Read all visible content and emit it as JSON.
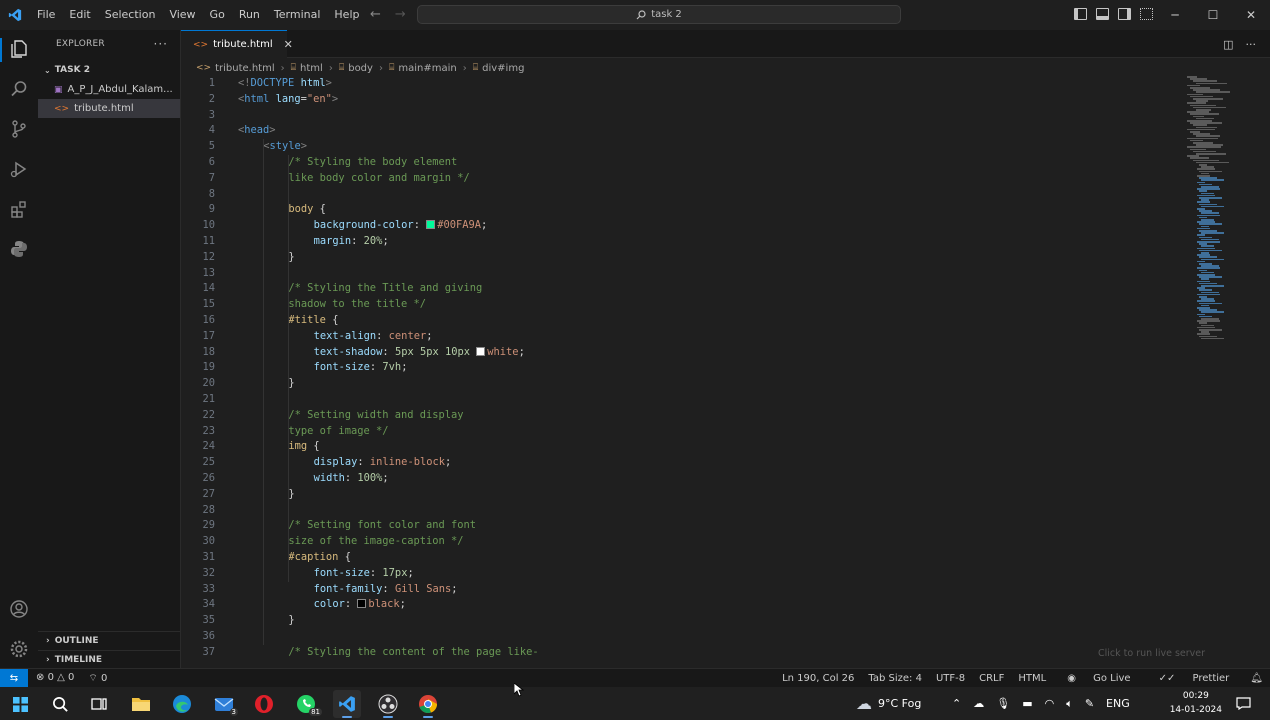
{
  "window": {
    "menu": [
      "File",
      "Edit",
      "Selection",
      "View",
      "Go",
      "Run",
      "Terminal",
      "Help"
    ],
    "search_text": "task 2"
  },
  "explorer": {
    "header": "EXPLORER",
    "folder": "TASK 2",
    "files": [
      {
        "name": "A_P_J_Abdul_Kalam...",
        "type": "image"
      },
      {
        "name": "tribute.html",
        "type": "html",
        "selected": true
      }
    ],
    "outline_label": "OUTLINE",
    "timeline_label": "TIMELINE"
  },
  "tab": {
    "label": "tribute.html"
  },
  "breadcrumb": [
    "tribute.html",
    "html",
    "body",
    "main#main",
    "div#img"
  ],
  "editor": {
    "lines": [
      {
        "n": "1",
        "tokens": [
          {
            "c": "punc",
            "t": "<!"
          },
          {
            "c": "tag",
            "t": "DOCTYPE"
          },
          {
            "c": "plain",
            "t": " "
          },
          {
            "c": "attr",
            "t": "html"
          },
          {
            "c": "punc",
            "t": ">"
          }
        ],
        "indent": 0
      },
      {
        "n": "2",
        "tokens": [
          {
            "c": "punc",
            "t": "<"
          },
          {
            "c": "tag",
            "t": "html"
          },
          {
            "c": "plain",
            "t": " "
          },
          {
            "c": "attr",
            "t": "lang"
          },
          {
            "c": "plain",
            "t": "="
          },
          {
            "c": "str",
            "t": "\"en\""
          },
          {
            "c": "punc",
            "t": ">"
          }
        ],
        "indent": 0
      },
      {
        "n": "3",
        "tokens": [],
        "indent": 0
      },
      {
        "n": "4",
        "tokens": [
          {
            "c": "punc",
            "t": "<"
          },
          {
            "c": "tag",
            "t": "head"
          },
          {
            "c": "punc",
            "t": ">"
          }
        ],
        "indent": 0
      },
      {
        "n": "5",
        "tokens": [
          {
            "c": "punc",
            "t": "<"
          },
          {
            "c": "tag",
            "t": "style"
          },
          {
            "c": "punc",
            "t": ">"
          }
        ],
        "indent": 1
      },
      {
        "n": "6",
        "tokens": [
          {
            "c": "com",
            "t": "/* Styling the body element"
          }
        ],
        "indent": 2
      },
      {
        "n": "7",
        "tokens": [
          {
            "c": "com",
            "t": "like body color and margin */"
          }
        ],
        "indent": 2
      },
      {
        "n": "8",
        "tokens": [],
        "indent": 0
      },
      {
        "n": "9",
        "tokens": [
          {
            "c": "sel",
            "t": "body"
          },
          {
            "c": "plain",
            "t": " {"
          }
        ],
        "indent": 2
      },
      {
        "n": "10",
        "tokens": [
          {
            "c": "prop",
            "t": "background-color"
          },
          {
            "c": "plain",
            "t": ": "
          },
          {
            "c": "swatch",
            "t": "#00FA9A"
          },
          {
            "c": "val",
            "t": "#00FA9A"
          },
          {
            "c": "plain",
            "t": ";"
          }
        ],
        "indent": 3
      },
      {
        "n": "11",
        "tokens": [
          {
            "c": "prop",
            "t": "margin"
          },
          {
            "c": "plain",
            "t": ": "
          },
          {
            "c": "num",
            "t": "20%"
          },
          {
            "c": "plain",
            "t": ";"
          }
        ],
        "indent": 3
      },
      {
        "n": "12",
        "tokens": [
          {
            "c": "plain",
            "t": "}"
          }
        ],
        "indent": 2
      },
      {
        "n": "13",
        "tokens": [],
        "indent": 0
      },
      {
        "n": "14",
        "tokens": [
          {
            "c": "com",
            "t": "/* Styling the Title and giving"
          }
        ],
        "indent": 2
      },
      {
        "n": "15",
        "tokens": [
          {
            "c": "com",
            "t": "shadow to the title */"
          }
        ],
        "indent": 2
      },
      {
        "n": "16",
        "tokens": [
          {
            "c": "sel",
            "t": "#title"
          },
          {
            "c": "plain",
            "t": " {"
          }
        ],
        "indent": 2
      },
      {
        "n": "17",
        "tokens": [
          {
            "c": "prop",
            "t": "text-align"
          },
          {
            "c": "plain",
            "t": ": "
          },
          {
            "c": "val",
            "t": "center"
          },
          {
            "c": "plain",
            "t": ";"
          }
        ],
        "indent": 3
      },
      {
        "n": "18",
        "tokens": [
          {
            "c": "prop",
            "t": "text-shadow"
          },
          {
            "c": "plain",
            "t": ": "
          },
          {
            "c": "num",
            "t": "5px 5px 10px"
          },
          {
            "c": "plain",
            "t": " "
          },
          {
            "c": "swatch",
            "t": "#ffffff"
          },
          {
            "c": "val",
            "t": "white"
          },
          {
            "c": "plain",
            "t": ";"
          }
        ],
        "indent": 3
      },
      {
        "n": "19",
        "tokens": [
          {
            "c": "prop",
            "t": "font-size"
          },
          {
            "c": "plain",
            "t": ": "
          },
          {
            "c": "num",
            "t": "7vh"
          },
          {
            "c": "plain",
            "t": ";"
          }
        ],
        "indent": 3
      },
      {
        "n": "20",
        "tokens": [
          {
            "c": "plain",
            "t": "}"
          }
        ],
        "indent": 2
      },
      {
        "n": "21",
        "tokens": [],
        "indent": 0
      },
      {
        "n": "22",
        "tokens": [
          {
            "c": "com",
            "t": "/* Setting width and display"
          }
        ],
        "indent": 2
      },
      {
        "n": "23",
        "tokens": [
          {
            "c": "com",
            "t": "type of image */"
          }
        ],
        "indent": 2
      },
      {
        "n": "24",
        "tokens": [
          {
            "c": "sel",
            "t": "img"
          },
          {
            "c": "plain",
            "t": " {"
          }
        ],
        "indent": 2
      },
      {
        "n": "25",
        "tokens": [
          {
            "c": "prop",
            "t": "display"
          },
          {
            "c": "plain",
            "t": ": "
          },
          {
            "c": "val",
            "t": "inline-block"
          },
          {
            "c": "plain",
            "t": ";"
          }
        ],
        "indent": 3
      },
      {
        "n": "26",
        "tokens": [
          {
            "c": "prop",
            "t": "width"
          },
          {
            "c": "plain",
            "t": ": "
          },
          {
            "c": "num",
            "t": "100%"
          },
          {
            "c": "plain",
            "t": ";"
          }
        ],
        "indent": 3
      },
      {
        "n": "27",
        "tokens": [
          {
            "c": "plain",
            "t": "}"
          }
        ],
        "indent": 2
      },
      {
        "n": "28",
        "tokens": [],
        "indent": 0
      },
      {
        "n": "29",
        "tokens": [
          {
            "c": "com",
            "t": "/* Setting font color and font"
          }
        ],
        "indent": 2
      },
      {
        "n": "30",
        "tokens": [
          {
            "c": "com",
            "t": "size of the image-caption */"
          }
        ],
        "indent": 2
      },
      {
        "n": "31",
        "tokens": [
          {
            "c": "sel",
            "t": "#caption"
          },
          {
            "c": "plain",
            "t": " {"
          }
        ],
        "indent": 2
      },
      {
        "n": "32",
        "tokens": [
          {
            "c": "prop",
            "t": "font-size"
          },
          {
            "c": "plain",
            "t": ": "
          },
          {
            "c": "num",
            "t": "17px"
          },
          {
            "c": "plain",
            "t": ";"
          }
        ],
        "indent": 3
      },
      {
        "n": "33",
        "tokens": [
          {
            "c": "prop",
            "t": "font-family"
          },
          {
            "c": "plain",
            "t": ": "
          },
          {
            "c": "val",
            "t": "Gill Sans"
          },
          {
            "c": "plain",
            "t": ";"
          }
        ],
        "indent": 3
      },
      {
        "n": "34",
        "tokens": [
          {
            "c": "prop",
            "t": "color"
          },
          {
            "c": "plain",
            "t": ": "
          },
          {
            "c": "swatch",
            "t": "#000000"
          },
          {
            "c": "val",
            "t": "black"
          },
          {
            "c": "plain",
            "t": ";"
          }
        ],
        "indent": 3
      },
      {
        "n": "35",
        "tokens": [
          {
            "c": "plain",
            "t": "}"
          }
        ],
        "indent": 2
      },
      {
        "n": "36",
        "tokens": [],
        "indent": 0
      },
      {
        "n": "37",
        "tokens": [
          {
            "c": "com",
            "t": "/* Styling the content of the page like-"
          }
        ],
        "indent": 2
      }
    ]
  },
  "hint": "Click to run live server",
  "statusbar": {
    "errors": "0",
    "warnings": "0",
    "ports": "0",
    "position": "Ln 190, Col 26",
    "tab_size": "Tab Size: 4",
    "encoding": "UTF-8",
    "eol": "CRLF",
    "language": "HTML",
    "live": "Go Live",
    "prettier": "Prettier"
  },
  "taskbar": {
    "mail_badge": "3",
    "whatsapp_badge": "81",
    "weather": "9°C  Fog",
    "lang": "ENG",
    "time": "00:29",
    "date": "14-01-2024"
  },
  "colors": {
    "accent": "#0078d4",
    "editor_bg": "#1f1f1f",
    "sidebar_bg": "#181818"
  }
}
